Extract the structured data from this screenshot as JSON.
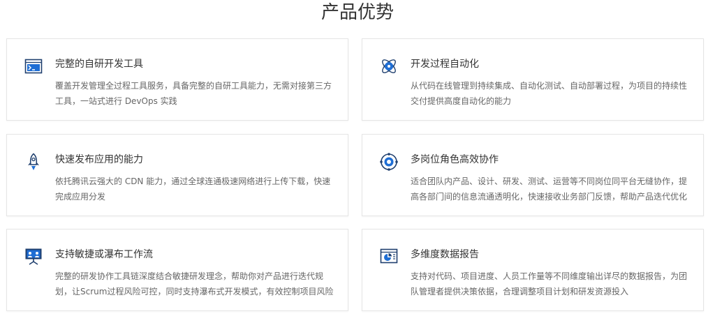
{
  "section": {
    "title": "产品优势"
  },
  "cards": [
    {
      "title": "完整的自研开发工具",
      "desc": "覆盖开发管理全过程工具服务，具备完整的自研工具能力，无需对接第三方工具，一站式进行 DevOps 实践",
      "icon": "terminal-window-icon"
    },
    {
      "title": "开发过程自动化",
      "desc": "从代码在线管理到持续集成、自动化测试、自动部署过程，为项目的持续性交付提供高度自动化的能力",
      "icon": "automation-orbit-icon"
    },
    {
      "title": "快速发布应用的能力",
      "desc": "依托腾讯云强大的 CDN 能力，通过全球连通极速网络进行上传下载，快速完成应用分发",
      "icon": "rocket-icon"
    },
    {
      "title": "多岗位角色高效协作",
      "desc": "适合团队内产品、设计、研发、测试、运营等不同岗位同平台无缝协作，提高各部门间的信息流通透明化，快速接收业务部门反馈，帮助产品迭代优化",
      "icon": "collaboration-target-icon"
    },
    {
      "title": "支持敏捷或瀑布工作流",
      "desc": "完整的研发协作工具链深度结合敏捷研发理念，帮助你对产品进行迭代规划，让Scrum过程风险可控，同时支持瀑布式开发模式，有效控制项目风险",
      "icon": "team-board-icon"
    },
    {
      "title": "多维度数据报告",
      "desc": "支持对代码、项目进度、人员工作量等不同维度输出详尽的数据报告，为团队管理者提供决策依据，合理调整项目计划和研发资源投入",
      "icon": "data-report-icon"
    }
  ],
  "colors": {
    "accent": "#1f6ed4",
    "title_text": "#333333",
    "body_text": "#666666",
    "border": "#e5e5e5"
  }
}
